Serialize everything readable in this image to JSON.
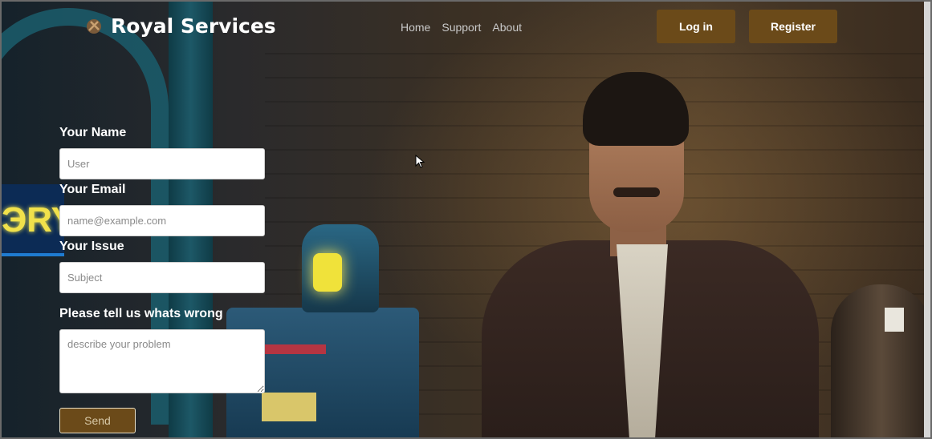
{
  "brand": {
    "name": "Royal Services",
    "icon": "crest-logo-icon"
  },
  "nav": {
    "items": [
      "Home",
      "Support",
      "About"
    ]
  },
  "auth": {
    "login_label": "Log in",
    "register_label": "Register"
  },
  "form": {
    "name_label": "Your Name",
    "name_placeholder": "User",
    "email_label": "Your Email",
    "email_placeholder": "name@example.com",
    "issue_label": "Your Issue",
    "issue_placeholder": "Subject",
    "message_label": "Please tell us whats wrong",
    "message_placeholder": "describe your problem",
    "send_label": "Send"
  },
  "background": {
    "neon_sign_text": "ЭRY"
  },
  "colors": {
    "accent": "#6b4a19",
    "text": "#ffffff",
    "nav_text": "#c9c9c9"
  }
}
